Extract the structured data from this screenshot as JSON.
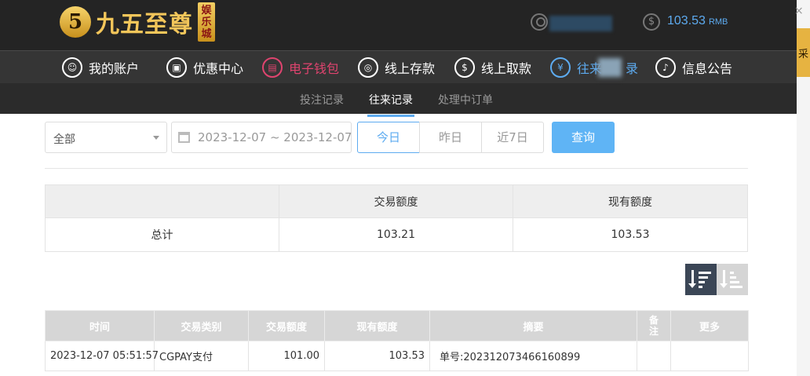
{
  "header": {
    "logo_glyph": "5",
    "logo_text": "九五至尊",
    "logo_badge": "娱乐城",
    "balance_value": "103.53",
    "balance_unit": "RMB",
    "coin_glyph": "$"
  },
  "side_tab": {
    "close": "×",
    "label": "采"
  },
  "nav": {
    "items": [
      {
        "label": "我的账户",
        "icon": "user-icon",
        "glyph": "☺"
      },
      {
        "label": "优惠中心",
        "icon": "gift-icon",
        "glyph": "▣"
      },
      {
        "label": "电子钱包",
        "icon": "wallet-icon",
        "glyph": "▤"
      },
      {
        "label": "线上存款",
        "icon": "deposit-icon",
        "glyph": "◎"
      },
      {
        "label": "线上取款",
        "icon": "withdraw-icon",
        "glyph": "$"
      },
      {
        "label": "往来",
        "label_tail": "录",
        "icon": "records-icon",
        "glyph": "¥"
      },
      {
        "label": "信息公告",
        "icon": "bell-icon",
        "glyph": "♪"
      }
    ]
  },
  "subnav": {
    "items": [
      "投注记录",
      "往来记录",
      "处理中订单"
    ]
  },
  "filter": {
    "select_value": "全部",
    "date_range": "2023-12-07 ~ 2023-12-07",
    "segments": [
      "今日",
      "昨日",
      "近7日"
    ],
    "query_label": "查询"
  },
  "summary": {
    "headers": [
      "",
      "交易额度",
      "现有额度"
    ],
    "row": [
      "总计",
      "103.21",
      "103.53"
    ]
  },
  "records": {
    "headers": [
      "时间",
      "交易类别",
      "交易额度",
      "现有额度",
      "摘要",
      "备注",
      "更多"
    ],
    "rows": [
      [
        "2023-12-07 05:51:57",
        "CGPAY支付",
        "101.00",
        "103.53",
        "单号:202312073466160899",
        "",
        ""
      ]
    ]
  },
  "colors": {
    "accent_blue": "#5dabf0",
    "active_pink": "#e0446f",
    "logo_gold": "#f3c65a"
  }
}
